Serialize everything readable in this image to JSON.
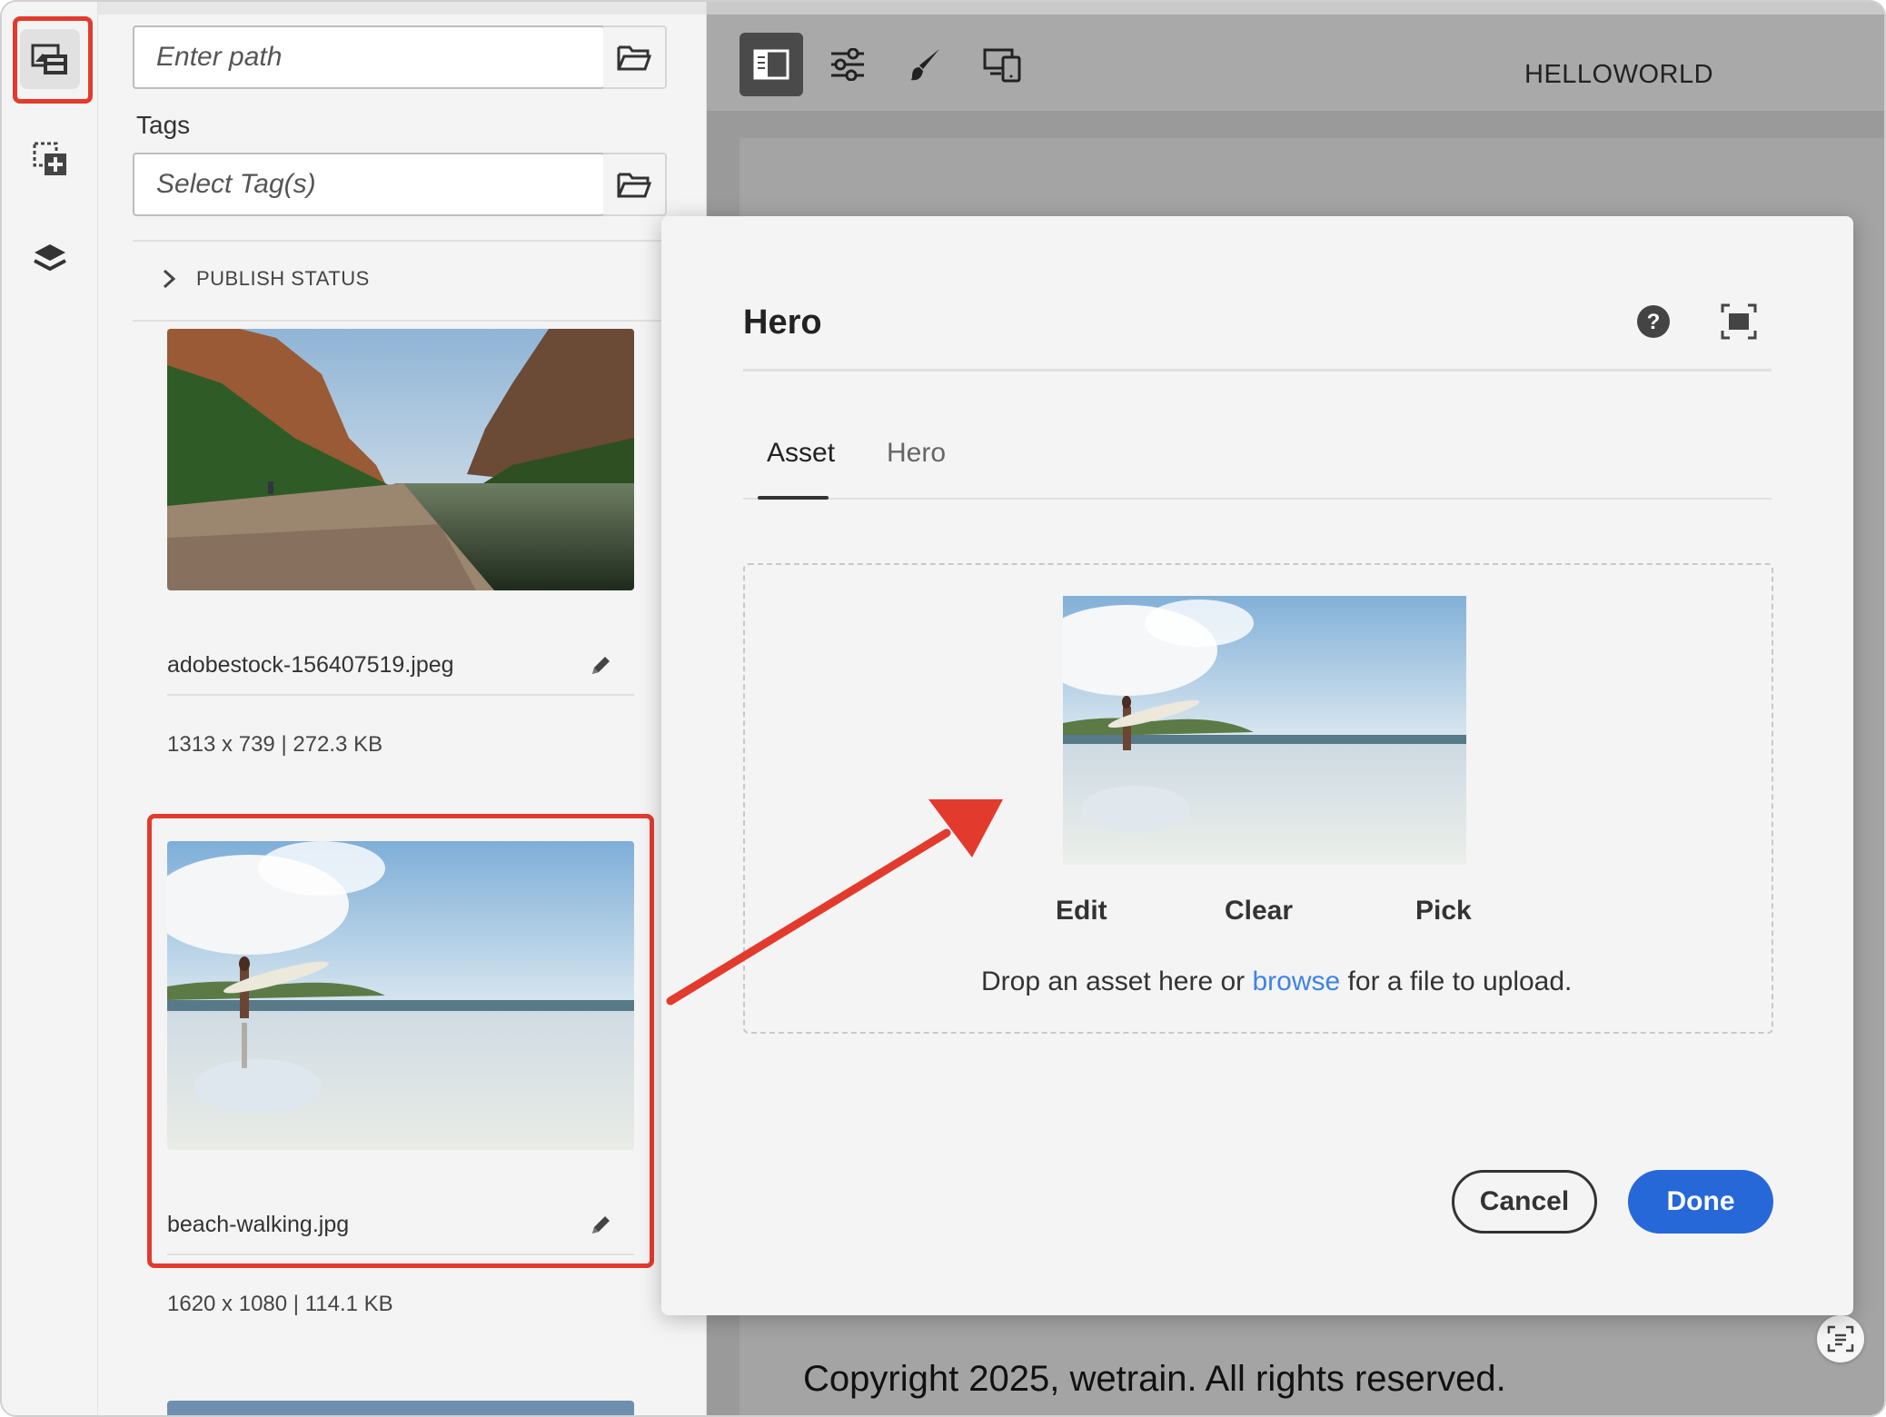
{
  "asset_panel": {
    "path_placeholder": "Enter path",
    "tags_label": "Tags",
    "tags_placeholder": "Select Tag(s)",
    "publish_status": "PUBLISH STATUS",
    "assets": [
      {
        "name": "adobestock-156407519.jpeg",
        "meta": "1313 x 739 | 272.3 KB"
      },
      {
        "name": "beach-walking.jpg",
        "meta": "1620 x 1080 | 114.1 KB"
      }
    ]
  },
  "editor": {
    "page_title": "HELLOWORLD",
    "footer_text": "Copyright 2025, wetrain. All rights reserved."
  },
  "dialog": {
    "title": "Hero",
    "tabs": [
      "Asset",
      "Hero"
    ],
    "active_tab": "Asset",
    "actions": {
      "edit": "Edit",
      "clear": "Clear",
      "pick": "Pick"
    },
    "drop_text_before": "Drop an asset here or ",
    "drop_link": "browse",
    "drop_text_after": " for a file to upload.",
    "cancel": "Cancel",
    "done": "Done"
  },
  "colors": {
    "accent": "#2768d8",
    "link": "#3d84e6",
    "highlight": "#e23b2e"
  },
  "icons": [
    "assets-icon",
    "components-icon",
    "layers-icon",
    "folder-icon",
    "chevron-right-icon",
    "pencil-icon",
    "side-panel-icon",
    "properties-icon",
    "style-brush-icon",
    "emulator-icon",
    "help-icon",
    "fullscreen-icon",
    "screenshot-icon"
  ]
}
